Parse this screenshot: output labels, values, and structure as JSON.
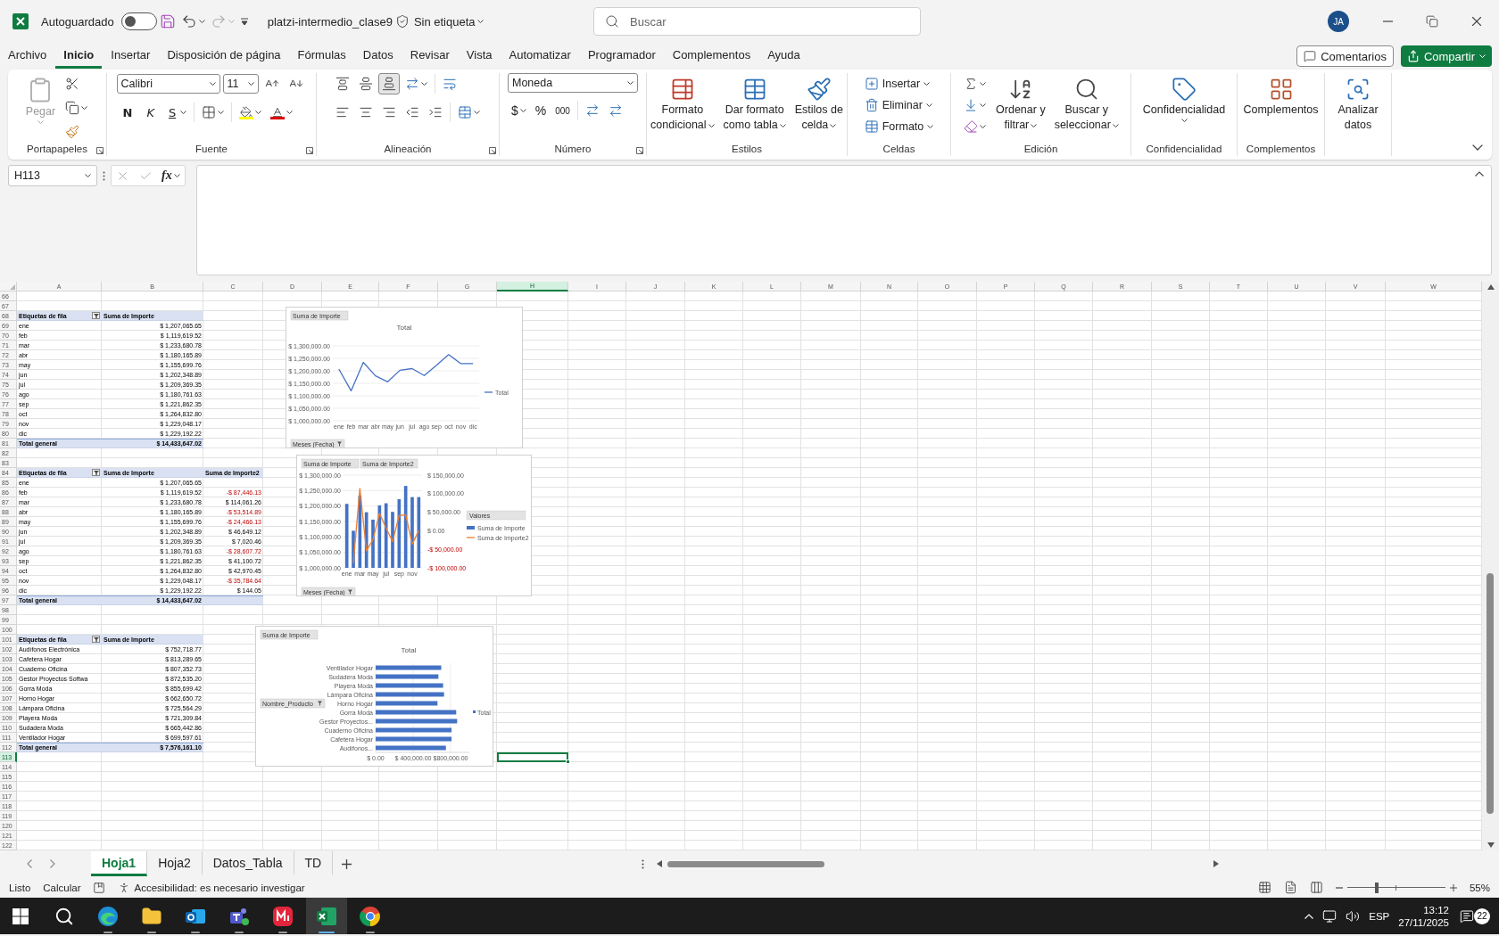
{
  "titlebar": {
    "autosave": {
      "label": "Autoguardado",
      "on": false
    },
    "redo": {
      "disabled": true
    },
    "filename": "platzi-intermedio_clase9",
    "sensitivity": "Sin etiqueta",
    "search": {
      "placeholder": "Buscar"
    },
    "avatar": "JA"
  },
  "menu": {
    "tabs": [
      {
        "label": "Archivo",
        "selected": false
      },
      {
        "label": "Inicio",
        "selected": true
      },
      {
        "label": "Insertar",
        "selected": false
      },
      {
        "label": "Disposición de página",
        "selected": false
      },
      {
        "label": "Fórmulas",
        "selected": false
      },
      {
        "label": "Datos",
        "selected": false
      },
      {
        "label": "Revisar",
        "selected": false
      },
      {
        "label": "Vista",
        "selected": false
      },
      {
        "label": "Automatizar",
        "selected": false
      },
      {
        "label": "Programador",
        "selected": false
      },
      {
        "label": "Complementos",
        "selected": false
      },
      {
        "label": "Ayuda",
        "selected": false
      }
    ],
    "comments": "Comentarios",
    "share": "Compartir"
  },
  "ribbon": {
    "groups": [
      {
        "kind": "clipboard",
        "label": "Portapapeles",
        "paste": {
          "label": "Pegar",
          "disabled": true
        }
      },
      {
        "kind": "font",
        "label": "Fuente",
        "family": "Calibri",
        "size": "11",
        "bold": "N",
        "italic": "K",
        "underline": "S"
      },
      {
        "kind": "alignment",
        "label": "Alineación",
        "vertical": [
          {
            "selected": false
          },
          {
            "selected": false
          },
          {
            "selected": true
          }
        ]
      },
      {
        "kind": "number",
        "label": "Número",
        "format": "Moneda",
        "currency": "$",
        "percent": "%",
        "thousands": "000"
      },
      {
        "kind": "styles",
        "label": "Estilos",
        "buttons": [
          {
            "lines": [
              "Formato",
              "condicional"
            ]
          },
          {
            "lines": [
              "Dar formato",
              "como tabla"
            ]
          },
          {
            "lines": [
              "Estilos de",
              "celda"
            ]
          }
        ]
      },
      {
        "kind": "cells",
        "label": "Celdas",
        "buttons": [
          "Insertar",
          "Eliminar",
          "Formato"
        ]
      },
      {
        "kind": "editing",
        "label": "Edición",
        "buttons": [
          {
            "lines": [
              "Ordenar y",
              "filtrar"
            ]
          },
          {
            "lines": [
              "Buscar y",
              "seleccionar"
            ]
          }
        ]
      },
      {
        "kind": "sensitivity",
        "label": "Confidencialidad",
        "button": "Confidencialidad"
      },
      {
        "kind": "addins",
        "label": "Complementos",
        "button": "Complementos"
      },
      {
        "kind": "analyze",
        "lines": [
          "Analizar",
          "datos"
        ]
      }
    ]
  },
  "formula_bar": {
    "name_box": "H113",
    "function_label": "fx"
  },
  "sheet": {
    "columns": [
      {
        "label": "A",
        "selected": false
      },
      {
        "label": "B",
        "selected": false
      },
      {
        "label": "C",
        "selected": false
      },
      {
        "label": "D",
        "selected": false
      },
      {
        "label": "E",
        "selected": false
      },
      {
        "label": "F",
        "selected": false
      },
      {
        "label": "G",
        "selected": false
      },
      {
        "label": "H",
        "selected": true
      },
      {
        "label": "I",
        "selected": false
      },
      {
        "label": "J",
        "selected": false
      },
      {
        "label": "K",
        "selected": false
      },
      {
        "label": "L",
        "selected": false
      },
      {
        "label": "M",
        "selected": false
      },
      {
        "label": "N",
        "selected": false
      },
      {
        "label": "O",
        "selected": false
      },
      {
        "label": "P",
        "selected": false
      },
      {
        "label": "Q",
        "selected": false
      },
      {
        "label": "R",
        "selected": false
      },
      {
        "label": "S",
        "selected": false
      },
      {
        "label": "T",
        "selected": false
      },
      {
        "label": "U",
        "selected": false
      },
      {
        "label": "V",
        "selected": false
      },
      {
        "label": "W",
        "selected": false
      }
    ],
    "rows": [
      {
        "number": "66",
        "selected": false
      },
      {
        "number": "67",
        "selected": false
      },
      {
        "number": "68",
        "selected": false
      },
      {
        "number": "69",
        "selected": false
      },
      {
        "number": "70",
        "selected": false
      },
      {
        "number": "71",
        "selected": false
      },
      {
        "number": "72",
        "selected": false
      },
      {
        "number": "73",
        "selected": false
      },
      {
        "number": "74",
        "selected": false
      },
      {
        "number": "75",
        "selected": false
      },
      {
        "number": "76",
        "selected": false
      },
      {
        "number": "77",
        "selected": false
      },
      {
        "number": "78",
        "selected": false
      },
      {
        "number": "79",
        "selected": false
      },
      {
        "number": "80",
        "selected": false
      },
      {
        "number": "81",
        "selected": false
      },
      {
        "number": "82",
        "selected": false
      },
      {
        "number": "83",
        "selected": false
      },
      {
        "number": "84",
        "selected": false
      },
      {
        "number": "85",
        "selected": false
      },
      {
        "number": "86",
        "selected": false
      },
      {
        "number": "87",
        "selected": false
      },
      {
        "number": "88",
        "selected": false
      },
      {
        "number": "89",
        "selected": false
      },
      {
        "number": "90",
        "selected": false
      },
      {
        "number": "91",
        "selected": false
      },
      {
        "number": "92",
        "selected": false
      },
      {
        "number": "93",
        "selected": false
      },
      {
        "number": "94",
        "selected": false
      },
      {
        "number": "95",
        "selected": false
      },
      {
        "number": "96",
        "selected": false
      },
      {
        "number": "97",
        "selected": false
      },
      {
        "number": "98",
        "selected": false
      },
      {
        "number": "99",
        "selected": false
      },
      {
        "number": "100",
        "selected": false
      },
      {
        "number": "101",
        "selected": false
      },
      {
        "number": "102",
        "selected": false
      },
      {
        "number": "103",
        "selected": false
      },
      {
        "number": "104",
        "selected": false
      },
      {
        "number": "105",
        "selected": false
      },
      {
        "number": "106",
        "selected": false
      },
      {
        "number": "107",
        "selected": false
      },
      {
        "number": "108",
        "selected": false
      },
      {
        "number": "109",
        "selected": false
      },
      {
        "number": "110",
        "selected": false
      },
      {
        "number": "111",
        "selected": false
      },
      {
        "number": "112",
        "selected": false
      },
      {
        "number": "113",
        "selected": true
      },
      {
        "number": "114",
        "selected": false
      },
      {
        "number": "115",
        "selected": false
      },
      {
        "number": "116",
        "selected": false
      },
      {
        "number": "117",
        "selected": false
      },
      {
        "number": "118",
        "selected": false
      },
      {
        "number": "119",
        "selected": false
      },
      {
        "number": "120",
        "selected": false
      },
      {
        "number": "121",
        "selected": false
      },
      {
        "number": "122",
        "selected": false
      }
    ],
    "pivot_tables": [
      {
        "columns": [
          "Etiquetas de fila",
          "Suma de Importe"
        ],
        "rows": [
          {
            "label": "ene",
            "value": "$ 1,207,065.65"
          },
          {
            "label": "feb",
            "value": "$ 1,119,619.52"
          },
          {
            "label": "mar",
            "value": "$ 1,233,680.78"
          },
          {
            "label": "abr",
            "value": "$ 1,180,165.89"
          },
          {
            "label": "may",
            "value": "$ 1,155,699.76"
          },
          {
            "label": "jun",
            "value": "$ 1,202,348.89"
          },
          {
            "label": "jul",
            "value": "$ 1,209,369.35"
          },
          {
            "label": "ago",
            "value": "$ 1,180,761.63"
          },
          {
            "label": "sep",
            "value": "$ 1,221,862.35"
          },
          {
            "label": "oct",
            "value": "$ 1,264,832.80"
          },
          {
            "label": "nov",
            "value": "$ 1,229,048.17"
          },
          {
            "label": "dic",
            "value": "$ 1,229,192.22"
          }
        ],
        "total": {
          "label": "Total general",
          "value": "$ 14,433,647.02"
        }
      },
      {
        "columns": [
          "Etiquetas de fila",
          "Suma de Importe",
          "Suma de Importe2"
        ],
        "rows": [
          {
            "label": "ene",
            "value": "$ 1,207,065.65"
          },
          {
            "label": "feb",
            "value": "$ 1,119,619.52",
            "change": {
              "text": "-$ 87,446.13",
              "negative": true
            }
          },
          {
            "label": "mar",
            "value": "$ 1,233,680.78",
            "change": {
              "text": "$ 114,061.26",
              "negative": false
            }
          },
          {
            "label": "abr",
            "value": "$ 1,180,165.89",
            "change": {
              "text": "-$ 53,514.89",
              "negative": true
            }
          },
          {
            "label": "may",
            "value": "$ 1,155,699.76",
            "change": {
              "text": "-$ 24,466.13",
              "negative": true
            }
          },
          {
            "label": "jun",
            "value": "$ 1,202,348.89",
            "change": {
              "text": "$ 46,649.12",
              "negative": false
            }
          },
          {
            "label": "jul",
            "value": "$ 1,209,369.35",
            "change": {
              "text": "$ 7,020.46",
              "negative": false
            }
          },
          {
            "label": "ago",
            "value": "$ 1,180,761.63",
            "change": {
              "text": "-$ 28,607.72",
              "negative": true
            }
          },
          {
            "label": "sep",
            "value": "$ 1,221,862.35",
            "change": {
              "text": "$ 41,100.72",
              "negative": false
            }
          },
          {
            "label": "oct",
            "value": "$ 1,264,832.80",
            "change": {
              "text": "$ 42,970.45",
              "negative": false
            }
          },
          {
            "label": "nov",
            "value": "$ 1,229,048.17",
            "change": {
              "text": "-$ 35,784.64",
              "negative": true
            }
          },
          {
            "label": "dic",
            "value": "$ 1,229,192.22",
            "change": {
              "text": "$ 144.05",
              "negative": false
            }
          }
        ],
        "total": {
          "label": "Total general",
          "value": "$ 14,433,647.02"
        }
      },
      {
        "columns": [
          "Etiquetas de fila",
          "Suma de Importe"
        ],
        "rows": [
          {
            "label": "Audífonos Electrónica",
            "value": "$ 752,718.77"
          },
          {
            "label": "Cafetera Hogar",
            "value": "$ 813,289.65"
          },
          {
            "label": "Cuaderno Oficina",
            "value": "$ 807,352.73"
          },
          {
            "label": "Gestor Proyectos Softwa",
            "value": "$ 872,535.20"
          },
          {
            "label": "Gorra Moda",
            "value": "$ 855,699.42"
          },
          {
            "label": "Horno Hogar",
            "value": "$ 662,650.72"
          },
          {
            "label": "Lámpara Oficina",
            "value": "$ 725,564.29"
          },
          {
            "label": "Playera Moda",
            "value": "$ 721,309.84"
          },
          {
            "label": "Sudadera Moda",
            "value": "$ 665,442.86"
          },
          {
            "label": "Ventilador Hogar",
            "value": "$ 699,597.61"
          }
        ],
        "total": {
          "label": "Total general",
          "value": "$ 7,576,161.10"
        }
      }
    ]
  },
  "charts": [
    {
      "field_buttons": [
        "Suma de Importe"
      ],
      "axis_button": "Meses (Fecha)",
      "chart_data": {
        "type": "line",
        "title": "Total",
        "grid": true,
        "legend": true,
        "categories": [
          "ene",
          "feb",
          "mar",
          "abr",
          "may",
          "jun",
          "jul",
          "ago",
          "sep",
          "oct",
          "nov",
          "dic"
        ],
        "series": [
          {
            "name": "Total",
            "color": "#4472c4",
            "values": [
              1207000,
              1120000,
              1234000,
              1180000,
              1156000,
              1202000,
              1209000,
              1181000,
              1222000,
              1265000,
              1229000,
              1229000
            ]
          }
        ],
        "ylim": [
          1000000,
          1300000
        ],
        "yticks": [
          {
            "value": 1000000,
            "label": "$ 1,000,000.00"
          },
          {
            "value": 1050000,
            "label": "$ 1,050,000.00"
          },
          {
            "value": 1100000,
            "label": "$ 1,100,000.00"
          },
          {
            "value": 1150000,
            "label": "$ 1,150,000.00"
          },
          {
            "value": 1200000,
            "label": "$ 1,200,000.00"
          },
          {
            "value": 1250000,
            "label": "$ 1,250,000.00"
          },
          {
            "value": 1300000,
            "label": "$ 1,300,000.00"
          }
        ]
      }
    },
    {
      "field_buttons": [
        "Suma de Importe",
        "Suma de Importe2"
      ],
      "axis_button": "Meses (Fecha)",
      "legend_title": "Valores",
      "chart_data": {
        "type": "bar",
        "grid": true,
        "legend": true,
        "categories": [
          "ene",
          null,
          "mar",
          null,
          "may",
          null,
          "jul",
          null,
          "sep",
          null,
          "nov",
          null
        ],
        "series": [
          {
            "name": "Suma de Importe",
            "type": "bar",
            "color": "#4472c4",
            "values": [
              1207000,
              1120000,
              1234000,
              1180000,
              1156000,
              1202000,
              1209000,
              1181000,
              1222000,
              1265000,
              1229000,
              1229000
            ]
          },
          {
            "name": "Suma de Importe2",
            "type": "line",
            "axis": "y2",
            "color": "#ed7d31",
            "values": [
              null,
              -87000,
              114000,
              -54000,
              -24000,
              47000,
              7000,
              -29000,
              41000,
              43000,
              -36000,
              0
            ]
          }
        ],
        "ylim": [
          1000000,
          1300000
        ],
        "yticks": [
          {
            "value": 1000000,
            "label": "$ 1,000,000.00"
          },
          {
            "value": 1050000,
            "label": "$ 1,050,000.00"
          },
          {
            "value": 1100000,
            "label": "$ 1,100,000.00"
          },
          {
            "value": 1150000,
            "label": "$ 1,150,000.00"
          },
          {
            "value": 1200000,
            "label": "$ 1,200,000.00"
          },
          {
            "value": 1250000,
            "label": "$ 1,250,000.00"
          },
          {
            "value": 1300000,
            "label": "$ 1,300,000.00"
          }
        ],
        "y2lim": [
          -100000,
          150000
        ],
        "y2ticks": [
          {
            "value": -100000,
            "label": "-$ 100,000.00"
          },
          {
            "value": -50000,
            "label": "-$ 50,000.00"
          },
          {
            "value": 0,
            "label": "$ 0.00"
          },
          {
            "value": 50000,
            "label": "$ 50,000.00"
          },
          {
            "value": 100000,
            "label": "$ 100,000.00"
          },
          {
            "value": 150000,
            "label": "$ 150,000.00"
          }
        ]
      }
    },
    {
      "field_buttons": [
        "Suma de Importe"
      ],
      "axis_button": "Nombre_Producto",
      "chart_data": {
        "type": "bar",
        "orientation": "horizontal",
        "title": "Total",
        "grid": true,
        "legend": true,
        "categories": [
          "Ventilador Hogar",
          "Sudadera Moda",
          "Playera Moda",
          "Lámpara Oficina",
          "Horno Hogar",
          "Gorra Moda",
          "Gestor Proyectos...",
          "Cuaderno Oficina",
          "Cafetera Hogar",
          "Audífonos..."
        ],
        "series": [
          {
            "name": "Total",
            "color": "#4472c4",
            "values": [
              700000,
              670000,
              720000,
              730000,
              660000,
              860000,
              870000,
              810000,
              810000,
              750000
            ]
          }
        ],
        "xlim": [
          0,
          1000000
        ],
        "xticks": [
          {
            "value": 0,
            "label": "$ 0.00"
          },
          {
            "value": 400000,
            "label": "$ 400,000.00"
          },
          {
            "value": 800000,
            "label": "$800,000.00"
          }
        ]
      }
    }
  ],
  "sheet_tabs": [
    {
      "label": "Hoja1",
      "selected": true
    },
    {
      "label": "Hoja2",
      "selected": false
    },
    {
      "label": "Datos_Tabla",
      "selected": false
    },
    {
      "label": "TD",
      "selected": false
    }
  ],
  "status_bar": {
    "mode": "Listo",
    "calculate": "Calcular",
    "accessibility": "Accesibilidad: es necesario investigar",
    "zoom": {
      "level": 0.3,
      "reading": "55%"
    }
  },
  "taskbar": {
    "apps": [
      {
        "kind": "start",
        "selected": false
      },
      {
        "kind": "search",
        "selected": false
      },
      {
        "kind": "browser",
        "selected": false
      },
      {
        "kind": "files",
        "selected": false
      },
      {
        "kind": "mail",
        "selected": false
      },
      {
        "kind": "chat",
        "selected": false
      },
      {
        "kind": "red",
        "selected": false
      },
      {
        "kind": "sheet",
        "selected": true
      },
      {
        "kind": "globe",
        "selected": false
      }
    ],
    "language": "ESP",
    "time": "13:12",
    "date": "27/11/2025",
    "notifications": "22"
  }
}
